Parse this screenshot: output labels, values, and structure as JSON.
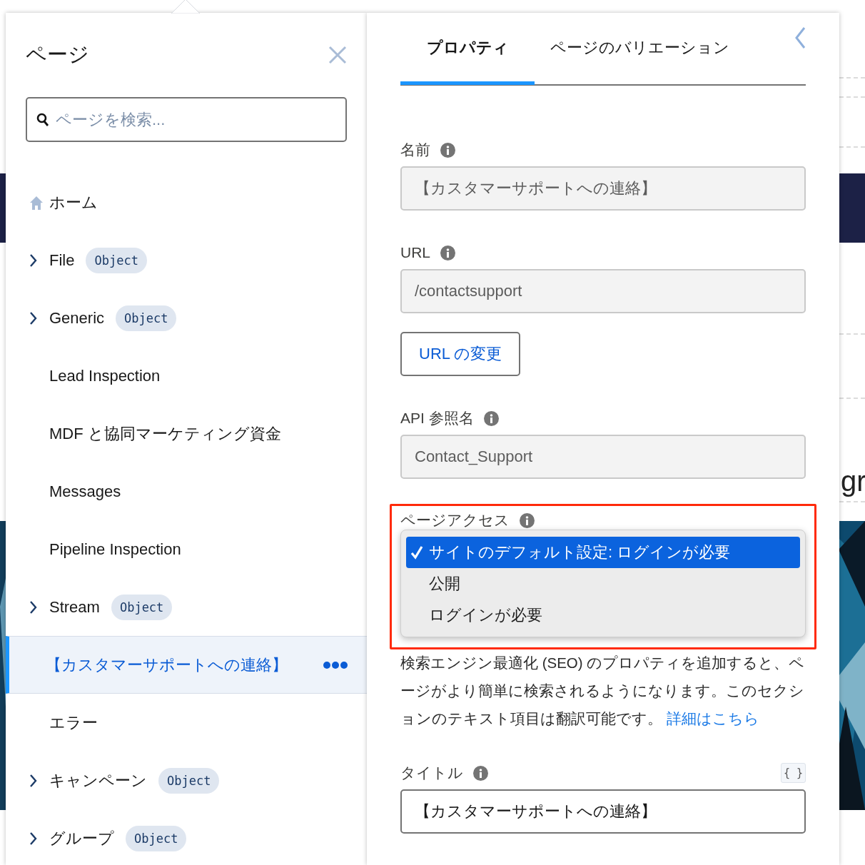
{
  "background_text": "gr",
  "pages_panel": {
    "title": "ページ",
    "search": {
      "placeholder": "ページを検索..."
    },
    "items": [
      {
        "kind": "home",
        "label": "ホーム",
        "has_children": false,
        "selected": false
      },
      {
        "kind": "page",
        "label": "File",
        "badge": "Object",
        "has_children": true,
        "selected": false
      },
      {
        "kind": "page",
        "label": "Generic",
        "badge": "Object",
        "has_children": true,
        "selected": false
      },
      {
        "kind": "page",
        "label": "Lead Inspection",
        "has_children": false,
        "selected": false
      },
      {
        "kind": "page",
        "label": "MDF と協同マーケティング資金",
        "has_children": false,
        "selected": false
      },
      {
        "kind": "page",
        "label": "Messages",
        "has_children": false,
        "selected": false
      },
      {
        "kind": "page",
        "label": "Pipeline Inspection",
        "has_children": false,
        "selected": false
      },
      {
        "kind": "page",
        "label": "Stream",
        "badge": "Object",
        "has_children": true,
        "selected": false
      },
      {
        "kind": "page",
        "label": "【カスタマーサポートへの連絡】",
        "has_children": false,
        "selected": true
      },
      {
        "kind": "page",
        "label": "エラー",
        "has_children": false,
        "selected": false
      },
      {
        "kind": "page",
        "label": "キャンペーン",
        "badge": "Object",
        "has_children": true,
        "selected": false
      },
      {
        "kind": "page",
        "label": "グループ",
        "badge": "Object",
        "has_children": true,
        "selected": false
      }
    ]
  },
  "properties_panel": {
    "tabs": [
      {
        "label": "プロパティ",
        "selected": true
      },
      {
        "label": "ページのバリエーション",
        "selected": false
      }
    ],
    "fields": [
      {
        "label": "名前",
        "value": "【カスタマーサポートへの連絡】"
      },
      {
        "label": "URL",
        "value": "/contactsupport"
      }
    ],
    "change_url_button": "URL の変更",
    "api_field": {
      "label": "API 参照名",
      "value": "Contact_Support"
    },
    "page_access": {
      "label": "ページアクセス",
      "options": [
        {
          "label": "サイトのデフォルト設定: ログインが必要",
          "selected": true
        },
        {
          "label": "公開",
          "selected": false
        },
        {
          "label": "ログインが必要",
          "selected": false
        }
      ]
    },
    "seo_text": "検索エンジン最適化 (SEO) のプロパティを追加すると、ページがより簡単に検索されるようになります。このセクションのテキスト項目は翻訳可能です。",
    "seo_link": "詳細はこちら",
    "title_field": {
      "label": "タイトル",
      "merge_button": "{ }",
      "value": "【カスタマーサポートへの連絡】"
    }
  }
}
